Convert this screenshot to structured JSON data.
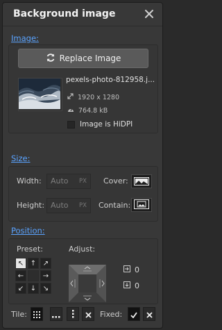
{
  "panel": {
    "title": "Background image"
  },
  "image_section": {
    "label": "Image:",
    "replace_label": "Replace Image",
    "file_name": "pexels-photo-812958.j...",
    "dimensions": "1920 x 1280",
    "file_size": "764.8 kB",
    "hidpi_label": "Image is HiDPI",
    "hidpi_checked": false
  },
  "size_section": {
    "label": "Size:",
    "width_label": "Width:",
    "width_placeholder": "Auto",
    "height_label": "Height:",
    "height_placeholder": "Auto",
    "unit": "PX",
    "cover_label": "Cover:",
    "contain_label": "Contain:"
  },
  "position_section": {
    "label": "Position:",
    "preset_label": "Preset:",
    "adjust_label": "Adjust:",
    "presets": [
      "↖",
      "↑",
      "↗",
      "←",
      "",
      "→",
      "↙",
      "↓",
      "↘"
    ],
    "selected_preset": 0,
    "x_value": "0",
    "y_value": "0"
  },
  "tile_row": {
    "tile_label": "Tile:",
    "fixed_label": "Fixed:"
  },
  "colors": {
    "accent": "#5aa3ff",
    "panel_bg": "#383838"
  }
}
